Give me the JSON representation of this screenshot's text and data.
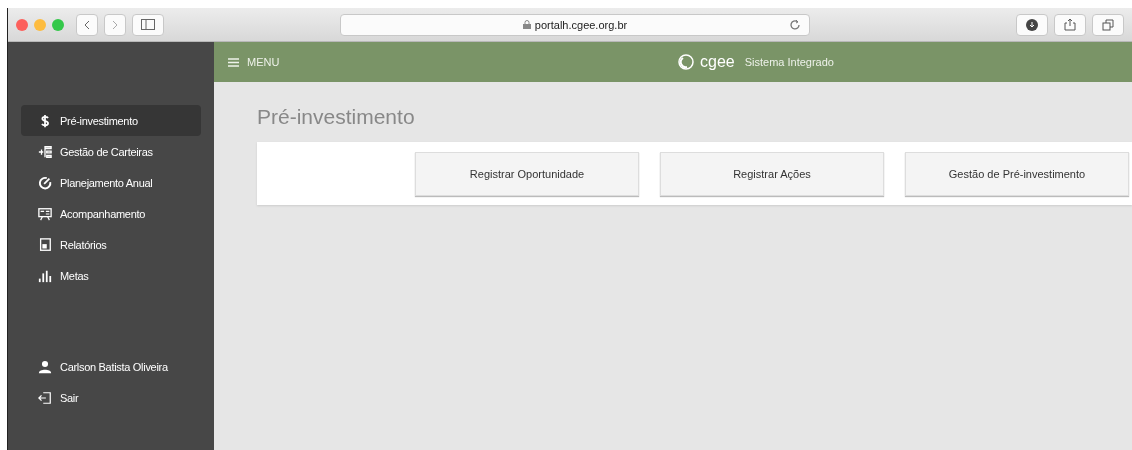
{
  "browser": {
    "url": "portalh.cgee.org.br"
  },
  "header": {
    "menu_label": "MENU",
    "logo_text": "cgee",
    "app_name": "Sistema Integrado"
  },
  "sidebar": {
    "items": [
      {
        "label": "Pré-investimento",
        "selected": true
      },
      {
        "label": "Gestão de Carteiras",
        "selected": false
      },
      {
        "label": "Planejamento Anual",
        "selected": false
      },
      {
        "label": "Acompanhamento",
        "selected": false
      },
      {
        "label": "Relatórios",
        "selected": false
      },
      {
        "label": "Metas",
        "selected": false
      }
    ],
    "user": "Carlson Batista Oliveira",
    "logout": "Sair"
  },
  "page": {
    "title": "Pré-investimento",
    "buttons": [
      "Registrar Oportunidade",
      "Registrar Ações",
      "Gestão de Pré-investimento"
    ]
  }
}
